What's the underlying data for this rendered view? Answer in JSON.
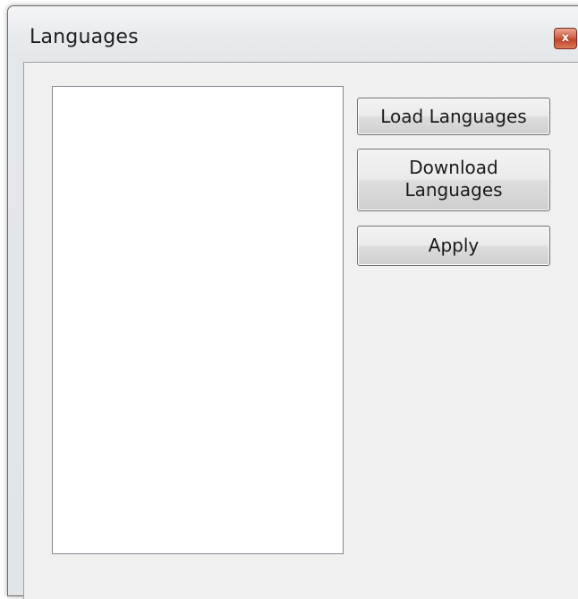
{
  "window": {
    "title": "Languages",
    "close_glyph": "x"
  },
  "list": {
    "items": []
  },
  "buttons": {
    "load_label": "Load Languages",
    "download_label": "Download\nLanguages",
    "apply_label": "Apply"
  }
}
